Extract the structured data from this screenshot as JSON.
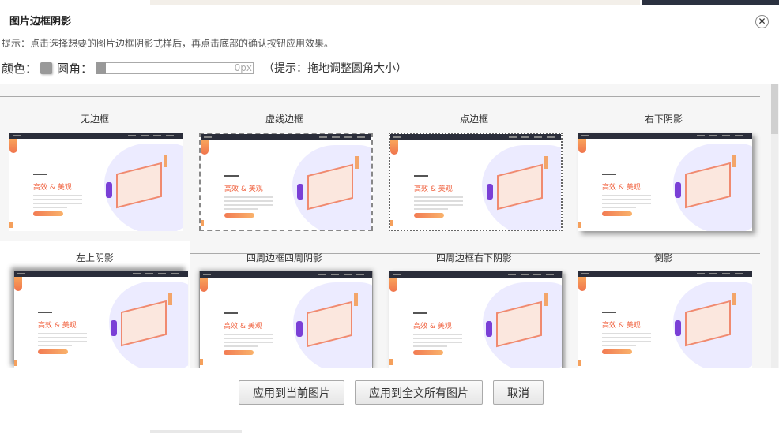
{
  "dialog": {
    "title": "图片边框阴影",
    "hint": "提示：点击选择想要的图片边框阴影式样后，再点击底部的确认按钮应用效果。",
    "color_label": "颜色：",
    "color_value": "#999999",
    "radius_label": "圆角：",
    "radius_value": "0px",
    "radius_hint": "（提示：拖地调整圆角大小）"
  },
  "thumbnail": {
    "headline": "高效 & 美观"
  },
  "styles": [
    {
      "label": "无边框"
    },
    {
      "label": "虚线边框"
    },
    {
      "label": "点边框"
    },
    {
      "label": "右下阴影"
    },
    {
      "label": "左上阴影",
      "selected": true
    },
    {
      "label": "四周边框四周阴影"
    },
    {
      "label": "四周边框右下阴影"
    },
    {
      "label": "倒影"
    }
  ],
  "buttons": {
    "apply_current": "应用到当前图片",
    "apply_all": "应用到全文所有图片",
    "cancel": "取消"
  }
}
